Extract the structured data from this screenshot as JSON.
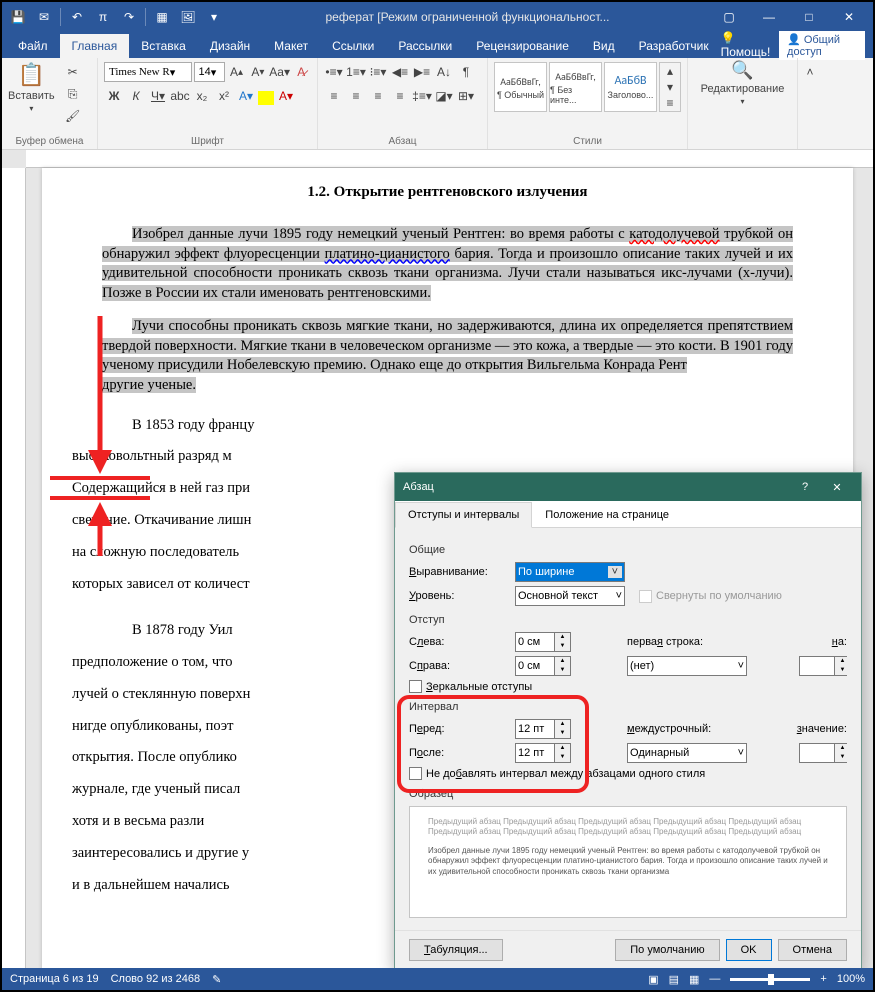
{
  "titlebar": {
    "title": "реферат [Режим ограниченной функциональност..."
  },
  "tabs": {
    "file": "Файл",
    "home": "Главная",
    "insert": "Вставка",
    "design": "Дизайн",
    "layout": "Макет",
    "references": "Ссылки",
    "mailings": "Рассылки",
    "review": "Рецензирование",
    "view": "Вид",
    "developer": "Разработчик",
    "help": "Помощь!",
    "share": "Общий доступ"
  },
  "ribbon": {
    "clipboard": {
      "label": "Буфер обмена",
      "paste": "Вставить"
    },
    "font": {
      "label": "Шрифт",
      "name": "Times New R",
      "size": "14"
    },
    "paragraph": {
      "label": "Абзац"
    },
    "styles": {
      "label": "Стили",
      "items": [
        {
          "preview": "АаБбВвГг,",
          "name": "¶ Обычный"
        },
        {
          "preview": "АаБбВвГг,",
          "name": "¶ Без инте..."
        },
        {
          "preview": "АаБбВ",
          "name": "Заголово..."
        }
      ]
    },
    "editing": {
      "label": "Редактирование"
    }
  },
  "document": {
    "heading": "1.2. Открытие рентгеновского излучения",
    "para1_part1": "Изобрел данные лучи 1895 году немецкий ученый Рентген: во время работы с ",
    "para1_wavy": "катодолучевой",
    "para1_part2": " трубкой он обнаружил эффект флуоресценции ",
    "para1_wavy2": "платино-цианистого",
    "para1_part3": " бария. Тогда и произошло описание таких лучей и их удивительной способности проникать сквозь ткани организма. Лучи стали называться икс-лучами (x-лучи). Позже в России их стали именовать рентгеновскими.",
    "para2_sel": "Лучи способны проникать сквозь мягкие ткани, но задерживаются, длина их определяется препятствием твердой поверхности. Мягкие ткани в человеческом организме — это кожа, а твердые — это кости. В 1901 году ученому присудили Нобелевскую премию. Однако еще до открытия Вильгельма Конрада Рент",
    "para2_rest": "другие ученые.",
    "para3": "В 1853 году францу",
    "para4": "высоковольтный разряд м",
    "para5": "Содержащийся в ней газ при",
    "para6": "свечение. Откачивание лишн",
    "para7": "на сложную последователь",
    "para8": "которых зависел от количест",
    "para9": "В 1878 году Уил",
    "para10": "предположение о том, что ",
    "para11": "лучей о стеклянную поверхн",
    "para12": "нигде опубликованы, поэт",
    "para13": "открытия. После опублико",
    "para14": "журнале, где ученый писал ",
    "para15": "хотя и в весьма разли",
    "para16": "заинтересовались и другие у",
    "para17": "и в дальнейшем начались"
  },
  "dialog": {
    "title": "Абзац",
    "tabs": {
      "indents": "Отступы и интервалы",
      "position": "Положение на странице"
    },
    "general": {
      "label": "Общие",
      "alignment_label": "Выравнивание:",
      "alignment_value": "По ширине",
      "level_label": "Уровень:",
      "level_value": "Основной текст",
      "collapse_label": "Свернуты по умолчанию"
    },
    "indent": {
      "label": "Отступ",
      "left_label": "Слева:",
      "left_value": "0 см",
      "right_label": "Справа:",
      "right_value": "0 см",
      "first_line_label": "первая строка:",
      "first_line_value": "(нет)",
      "by_label": "на:",
      "mirror_label": "Зеркальные отступы"
    },
    "spacing": {
      "label": "Интервал",
      "before_label": "Перед:",
      "before_value": "12 пт",
      "after_label": "После:",
      "after_value": "12 пт",
      "line_label": "междустрочный:",
      "line_value": "Одинарный",
      "value_label": "значение:",
      "no_space_label": "Не добавлять интервал между абзацами одного стиля"
    },
    "preview": {
      "label": "Образец",
      "text1": "Предыдущий абзац Предыдущий абзац Предыдущий абзац Предыдущий абзац Предыдущий абзац Предыдущий абзац Предыдущий абзац Предыдущий абзац Предыдущий абзац Предыдущий абзац",
      "text2": "Изобрел данные лучи 1895 году немецкий ученый Рентген: во время работы с катодолучевой трубкой он обнаружил эффект флуоресценции платино-цианистого бария. Тогда и произошло описание таких лучей и их удивительной способности проникать сквозь ткани организма"
    },
    "buttons": {
      "tabs": "Табуляция...",
      "default": "По умолчанию",
      "ok": "OK",
      "cancel": "Отмена"
    }
  },
  "statusbar": {
    "page": "Страница 6 из 19",
    "words": "Слово 92 из 2468",
    "zoom": "100%"
  }
}
